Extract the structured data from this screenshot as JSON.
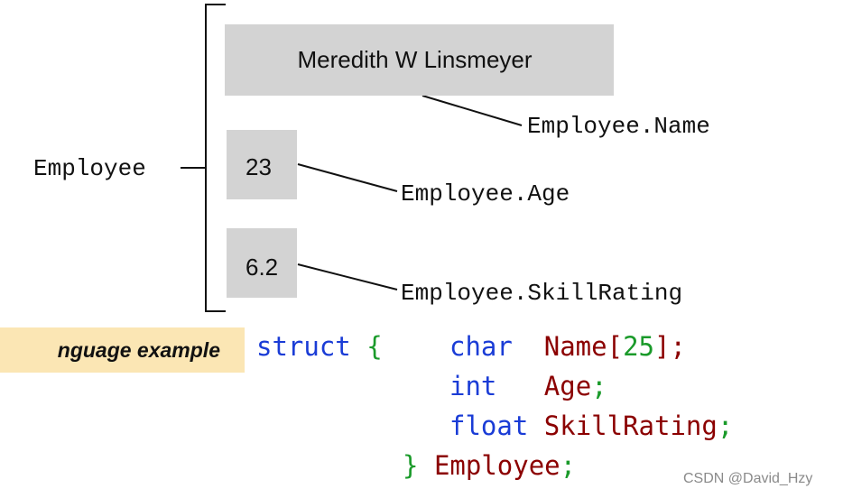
{
  "diagram": {
    "struct_label": "Employee",
    "fields": [
      {
        "value": "Meredith W Linsmeyer",
        "label": "Employee.Name"
      },
      {
        "value": "23",
        "label": "Employee.Age"
      },
      {
        "value": "6.2",
        "label": "Employee.SkillRating"
      }
    ]
  },
  "language_label": "nguage example",
  "code": {
    "line1": {
      "keyword": "struct",
      "brace": "{",
      "type": "char",
      "name": "Name[",
      "size": "25",
      "end": "];"
    },
    "line2": {
      "type": "int",
      "name": "Age",
      "end": ";"
    },
    "line3": {
      "type": "float",
      "name": "SkillRating",
      "end": ";"
    },
    "line4": {
      "brace": "}",
      "name": "Employee",
      "end": ";"
    }
  },
  "watermark": "CSDN @David_Hzy",
  "colors": {
    "box_fill": "#d3d3d3",
    "label_bg": "#fbe6b4",
    "keyword": "#1a3cd6",
    "brace": "#1a9a2a",
    "identifier": "#8b0000"
  }
}
